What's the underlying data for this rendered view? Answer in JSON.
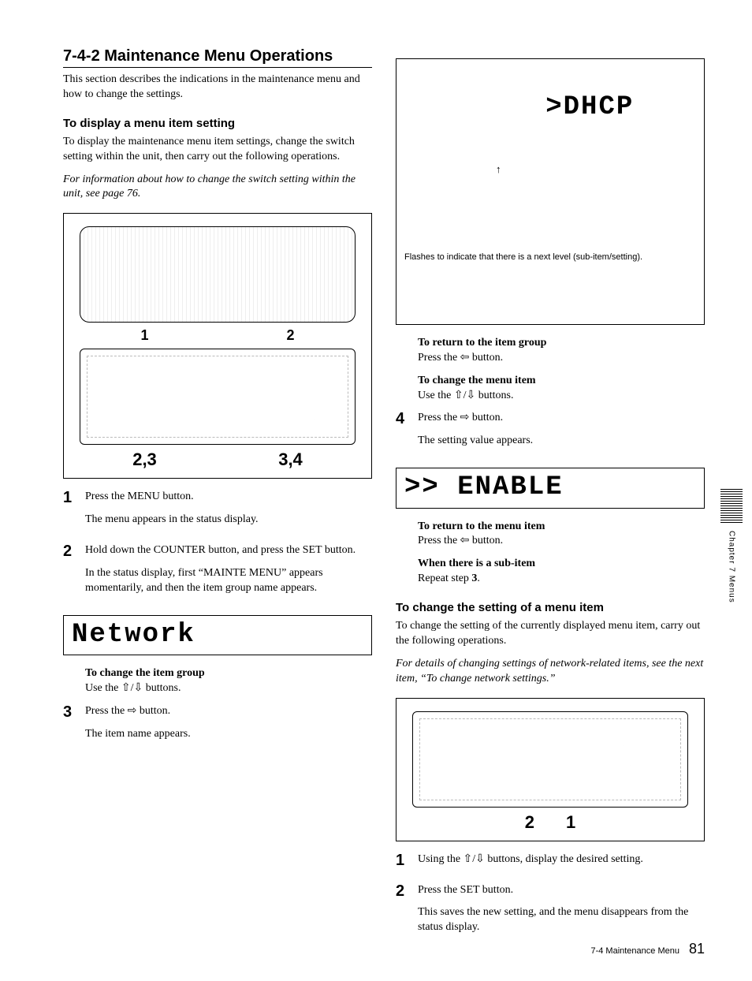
{
  "section_heading": "7-4-2 Maintenance Menu Operations",
  "intro": "This section describes the indications in the maintenance menu and how to change the settings.",
  "left": {
    "h_display": "To display a menu item setting",
    "p_display": "To display the maintenance menu item settings, change the switch setting within the unit, then carry out the following operations.",
    "p_ref_switch": "For information about how to change the switch setting within the unit, see page 76.",
    "fig1_top_labels": {
      "a": "1",
      "b": "2"
    },
    "fig1_bottom_labels": {
      "a": "2,3",
      "b": "3,4"
    },
    "step1_num": "1",
    "step1_a": "Press the MENU button.",
    "step1_b": "The menu appears in the status display.",
    "step2_num": "2",
    "step2_a": "Hold down the COUNTER button, and press the SET button.",
    "step2_b": "In the status display, first “MAINTE MENU” appears momentarily, and then the item group name appears.",
    "lcd_network": "Network",
    "sub_change_group_h": "To change the item group",
    "sub_change_group_p": "Use the ⇧/⇩ buttons.",
    "step3_num": "3",
    "step3_a": "Press the ⇨ button.",
    "step3_b": "The item name appears."
  },
  "right": {
    "lcd_dhcp": ">DHCP",
    "lcd_dhcp_caption": "Flashes to indicate that there is a next level (sub-item/setting).",
    "sub_return_group_h": "To return to the item group",
    "sub_return_group_p": "Press the ⇦ button.",
    "sub_change_item_h": "To change the menu item",
    "sub_change_item_p": "Use the ⇧/⇩ buttons.",
    "step4_num": "4",
    "step4_a": "Press the ⇨ button.",
    "step4_b": "The setting value appears.",
    "lcd_enable": ">> ENABLE",
    "sub_return_item_h": "To return to the menu item",
    "sub_return_item_p": "Press the ⇦ button.",
    "sub_subitem_h": "When there is a sub-item",
    "sub_subitem_p": "Repeat step 3.",
    "h_change": "To change the setting of a menu item",
    "p_change": "To change the setting of the currently displayed menu item, carry out the following operations.",
    "p_ref_network": "For details of changing settings of network-related items, see the next item, “To change network settings.”",
    "fig2_labels": {
      "a": "2",
      "b": "1"
    },
    "cstep1_num": "1",
    "cstep1_a": "Using the ⇧/⇩ buttons, display the desired setting.",
    "cstep2_num": "2",
    "cstep2_a": "Press the SET button.",
    "cstep2_b": "This saves the new setting, and the menu disappears from the status display."
  },
  "sidebar_text": "Chapter 7  Menus",
  "footer_section": "7-4 Maintenance Menu",
  "footer_page": "81"
}
